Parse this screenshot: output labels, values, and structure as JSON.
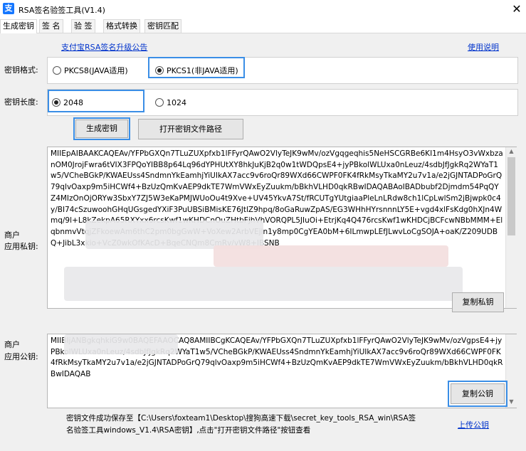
{
  "window": {
    "logo_text": "支",
    "title": "RSA签名验签工具(V1.4)",
    "close_glyph": "✕"
  },
  "tabs": [
    {
      "label": "生成密钥",
      "active": true
    },
    {
      "label": "签 名",
      "active": false
    },
    {
      "label": "验 签",
      "active": false
    },
    {
      "label": "格式转换",
      "active": false
    },
    {
      "label": "密钥匹配",
      "active": false
    }
  ],
  "links": {
    "upgrade_notice": "支付宝RSA签名升级公告",
    "help": "使用说明",
    "upload_public_key": "上传公钥"
  },
  "key_format": {
    "label": "密钥格式:",
    "options": [
      {
        "label": "PKCS8(JAVA适用)",
        "selected": false
      },
      {
        "label": "PKCS1(非JAVA适用)",
        "selected": true
      }
    ]
  },
  "key_length": {
    "label": "密钥长度:",
    "options": [
      {
        "label": "2048",
        "selected": true
      },
      {
        "label": "1024",
        "selected": false
      }
    ]
  },
  "buttons": {
    "generate": "生成密钥",
    "open_path": "打开密钥文件路径",
    "copy_private": "复制私钥",
    "copy_public": "复制公钥"
  },
  "private_key": {
    "label_line1": "商户",
    "label_line2": "应用私钥:",
    "text": "MIIEpAIBAAKCAQEAv/YFPbGXQn7TLuZUXpfxb1lFFyrQAwO2VlyTeJK9wMv/ozVgqgeqhis5NeHSCGRBe6KI1m4HsyO3vWxbzanOM0JrojFwra6tVIX3FPQoYIBB8p64Lq96dYPHUtXY8hkJuKjB2q0w1tWDQpsE4+jyPBkolWLUxa0nLeuz/4sdbJfJgkRq2WYaT1w5/VCheBGkP/KWAEUss4SndmnYkEamhjYiUIkAX7acc9v6roQr89WXd66CWPF0FK4fRkMsyTkaMY2u7v1a/e2jGJNTADPoGrQ79qlvOaxp9m5iHCWf4+BzUzQmKvAEP9dkTE7WmVWxEyZuukm/bBkhVLHD0qkRBwIDAQABAoIBADbubf2Djmdm54PqQYZ4MIzOnOjORYw3SbxY7ZJ5W3eKaPMJWUoOu4t9Xve+UV45YkvA7St/fRCUTgYUtgiaaPleLnLRdw8ch1lCpLwlSm2jBjwpk0c4y/BI74cSzuwoohGHqUGsgedYXiF3PuUBSiBMisKE76JtlZ9hpq/8oGaRuwZpAS/EG3WHhHYrsnnnLY5E+vgd4xlFsKdg0hXJn4Wmq/9l+L8kZekpA65RXYxx6rcsKwf1wKHDCnOuZHtbFjhVhVORQPL5JIuOi+EtrjKq4Q476rcsKwf1wKHDCjBCFcwNBbMMM+ElqbnmvVtqjZFkoewAm6thC2pm0bgGwW+VoXew2ArbVEjln1y8mp0CgYEA0bM+6ILmwpLEfJLwvLoCgSOJA+oaK/Z209UDBQ+JibL3xkio+VcZ0wkOfKAcD+BqeCNQm8CmRv/vW8+JBSNB"
  },
  "public_key": {
    "label_line1": "商户",
    "label_line2": "应用公钥:",
    "text": "MIIBIjANBgkqhkiG9w0BAQEFAAOCAQ8AMIIBCgKCAQEAv/YFPbGXQn7TLuZUXpfxb1lFFyrQAwO2VlyTeJK9wMv/ozVgpsE4+jyPBkolWLUxa0nLeuz/4sdbJfJgkRq2WYaT1w5/VCheBGkP/KWAEUss4SndmnYkEamhjYiUIkAX7acc9v6roQr89WXd66CWPF0FK4fRkMsyTkaMY2u7v1a/e2jGJNTADPoGrQ79qlvOaxp9m5iHCWf4+BzUzQmKvAEP9dkTE7WmVWxEyZuukm/bBkhVLHD0qkRBwIDAQAB"
  },
  "status": {
    "line1": "密钥文件成功保存至【C:\\Users\\foxteam1\\Desktop\\搜狗高速下载\\secret_key_tools_RSA_win\\RSA签",
    "line2": "名验签工具windows_V1.4\\RSA密钥】,点击\"打开密钥文件路径\"按钮查看"
  },
  "icons": {
    "scroll_up": "up-arrow-icon",
    "scroll_down": "down-arrow-icon"
  }
}
